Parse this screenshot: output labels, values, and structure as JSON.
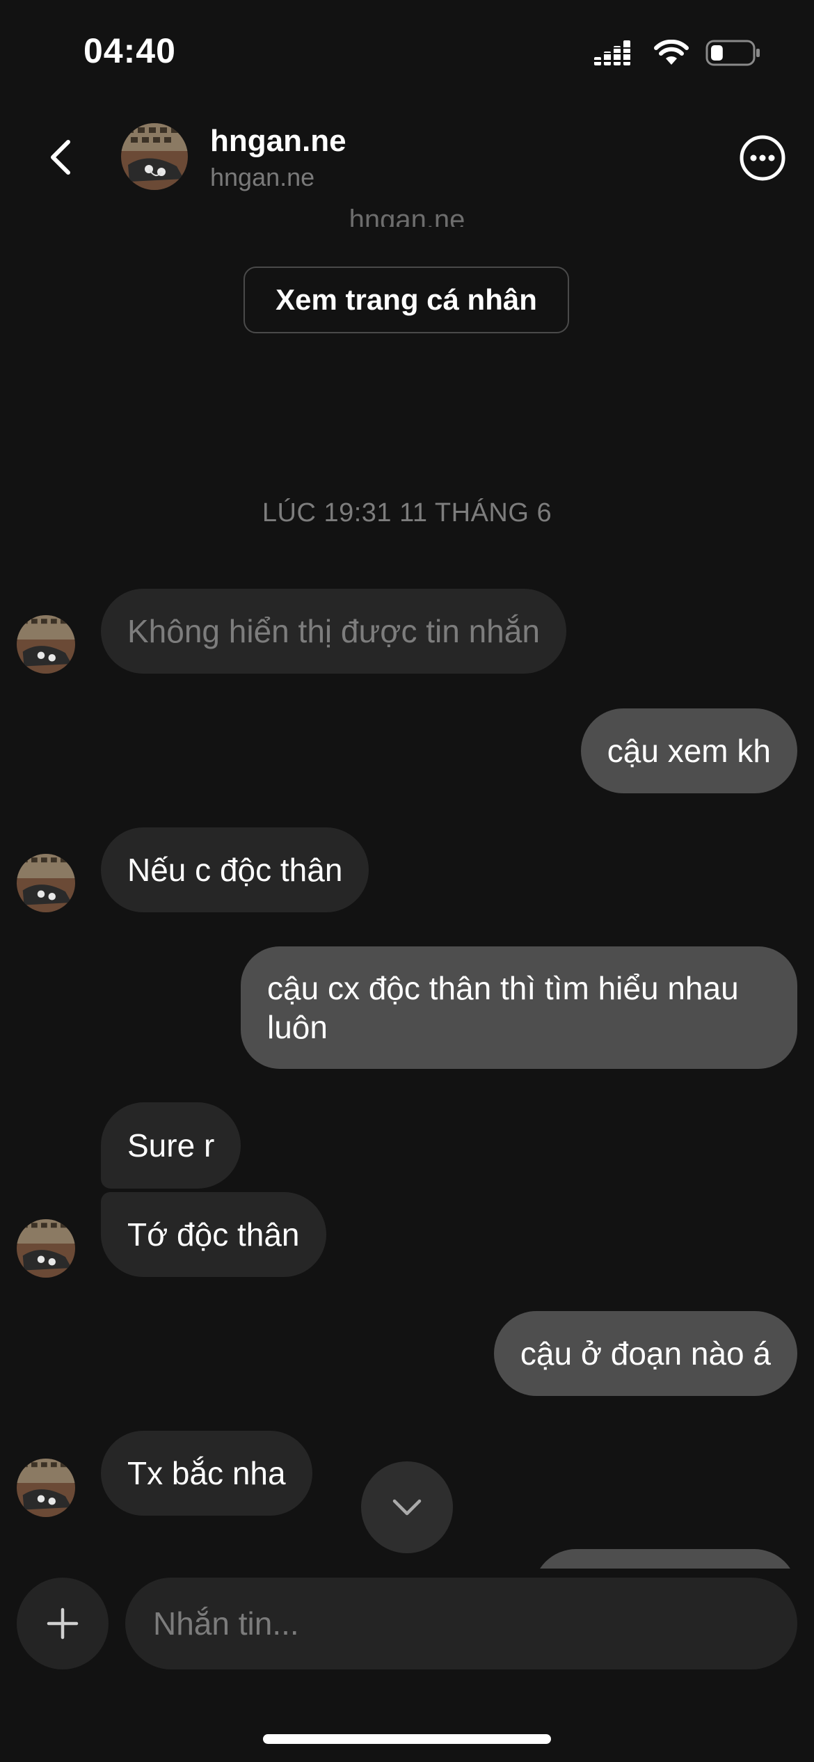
{
  "status_bar": {
    "time": "04:40",
    "battery_level": 0.3
  },
  "header": {
    "name": "hngan.ne",
    "username": "hngan.ne"
  },
  "profile": {
    "partial_name": "hngan.ne",
    "view_profile_label": "Xem trang cá nhân"
  },
  "thread": {
    "timestamp": "LÚC 19:31 11 THÁNG 6",
    "messages": [
      {
        "from": "them",
        "text": "Không hiển thị được tin nhắn",
        "unavailable": true
      },
      {
        "from": "me",
        "text": "cậu xem kh"
      },
      {
        "from": "them",
        "text": "Nếu c độc thân"
      },
      {
        "from": "me",
        "text": "cậu cx độc thân thì tìm hiểu nhau luôn"
      },
      {
        "from": "them",
        "text": "Sure r"
      },
      {
        "from": "them",
        "text": "Tớ độc thân"
      },
      {
        "from": "me",
        "text": "cậu ở đoạn nào á"
      },
      {
        "from": "them",
        "text": "Tx bắc nha"
      }
    ]
  },
  "composer": {
    "placeholder": "Nhắn tin..."
  },
  "icons": {
    "back": "chevron-left-icon",
    "more": "more-options-icon",
    "scroll": "chevron-down-icon",
    "add": "plus-icon",
    "signal": "signal-icon",
    "wifi": "wifi-icon",
    "battery": "battery-icon"
  }
}
